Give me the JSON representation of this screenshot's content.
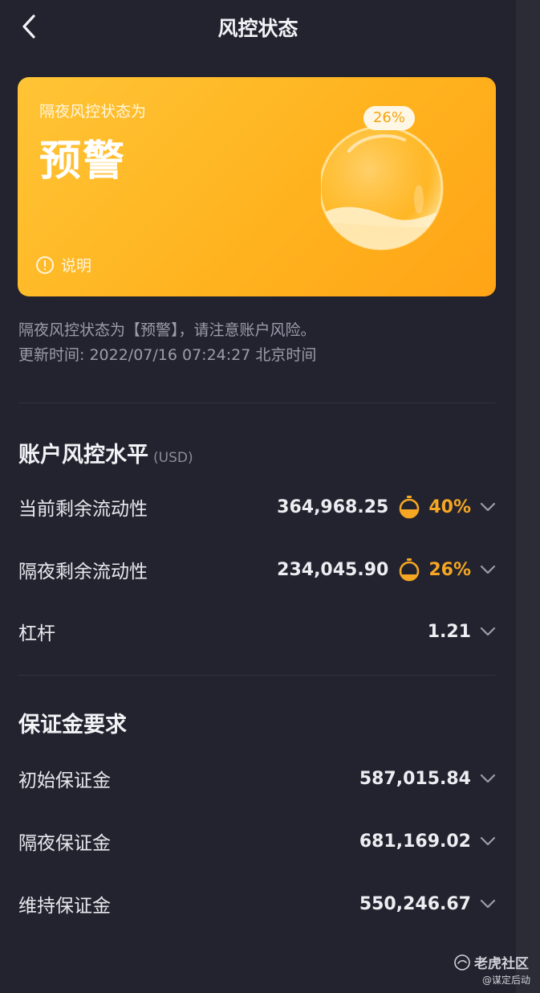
{
  "header": {
    "title": "风控状态"
  },
  "card": {
    "subtitle": "隔夜风控状态为",
    "status": "预警",
    "percent_label": "26%",
    "fill_level": 0.26,
    "explain_label": "说明",
    "colors": {
      "gradient_start": "#ffc436",
      "gradient_end": "#ffa416"
    }
  },
  "notice": {
    "line1": "隔夜风控状态为【预警】，请注意账户风险。",
    "line2": "更新时间: 2022/07/16 07:24:27 北京时间"
  },
  "risk_section": {
    "title": "账户风控水平",
    "unit": "(USD)",
    "rows": [
      {
        "label": "当前剩余流动性",
        "value": "364,968.25",
        "percent": "40%",
        "gauge_level": 0.4
      },
      {
        "label": "隔夜剩余流动性",
        "value": "234,045.90",
        "percent": "26%",
        "gauge_level": 0.26
      },
      {
        "label": "杠杆",
        "value": "1.21"
      }
    ]
  },
  "margin_section": {
    "title": "保证金要求",
    "rows": [
      {
        "label": "初始保证金",
        "value": "587,015.84"
      },
      {
        "label": "隔夜保证金",
        "value": "681,169.02"
      },
      {
        "label": "维持保证金",
        "value": "550,246.67"
      }
    ]
  },
  "watermark": {
    "main": "老虎社区",
    "sub": "@谋定后动"
  },
  "colors": {
    "background": "#22232e",
    "accent": "#f5a623",
    "text_primary": "#e8e9ee",
    "text_secondary": "#9a9daa"
  },
  "icons": {
    "back": "chevron-left-icon",
    "info": "info-circle-icon",
    "gauge": "timer-gauge-icon",
    "expand": "chevron-down-icon"
  }
}
